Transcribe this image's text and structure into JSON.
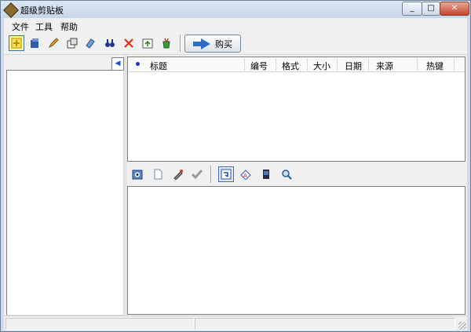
{
  "window": {
    "title": "超级剪贴板"
  },
  "menu": [
    "文件",
    "工具",
    "帮助"
  ],
  "toolbar": {
    "icons": [
      "new-clip-icon",
      "box-icon",
      "pencil-icon",
      "properties-icon",
      "brush-icon",
      "binoculars-icon",
      "delete-icon",
      "export-icon",
      "cup-icon"
    ],
    "buy_label": "购买"
  },
  "list": {
    "columns": [
      "标题",
      "编号",
      "格式",
      "大小",
      "日期",
      "来源",
      "热键"
    ],
    "rows": []
  },
  "preview_toolbar": {
    "icons": [
      "camera-icon",
      "document-icon",
      "tools-icon",
      "check-icon",
      "paste-into-icon",
      "text-format-icon",
      "book-icon",
      "magnifier-icon"
    ]
  },
  "colors": {
    "frame": "#cfdbe9",
    "accent": "#1b4fd1",
    "close_button": "#c4452b"
  }
}
